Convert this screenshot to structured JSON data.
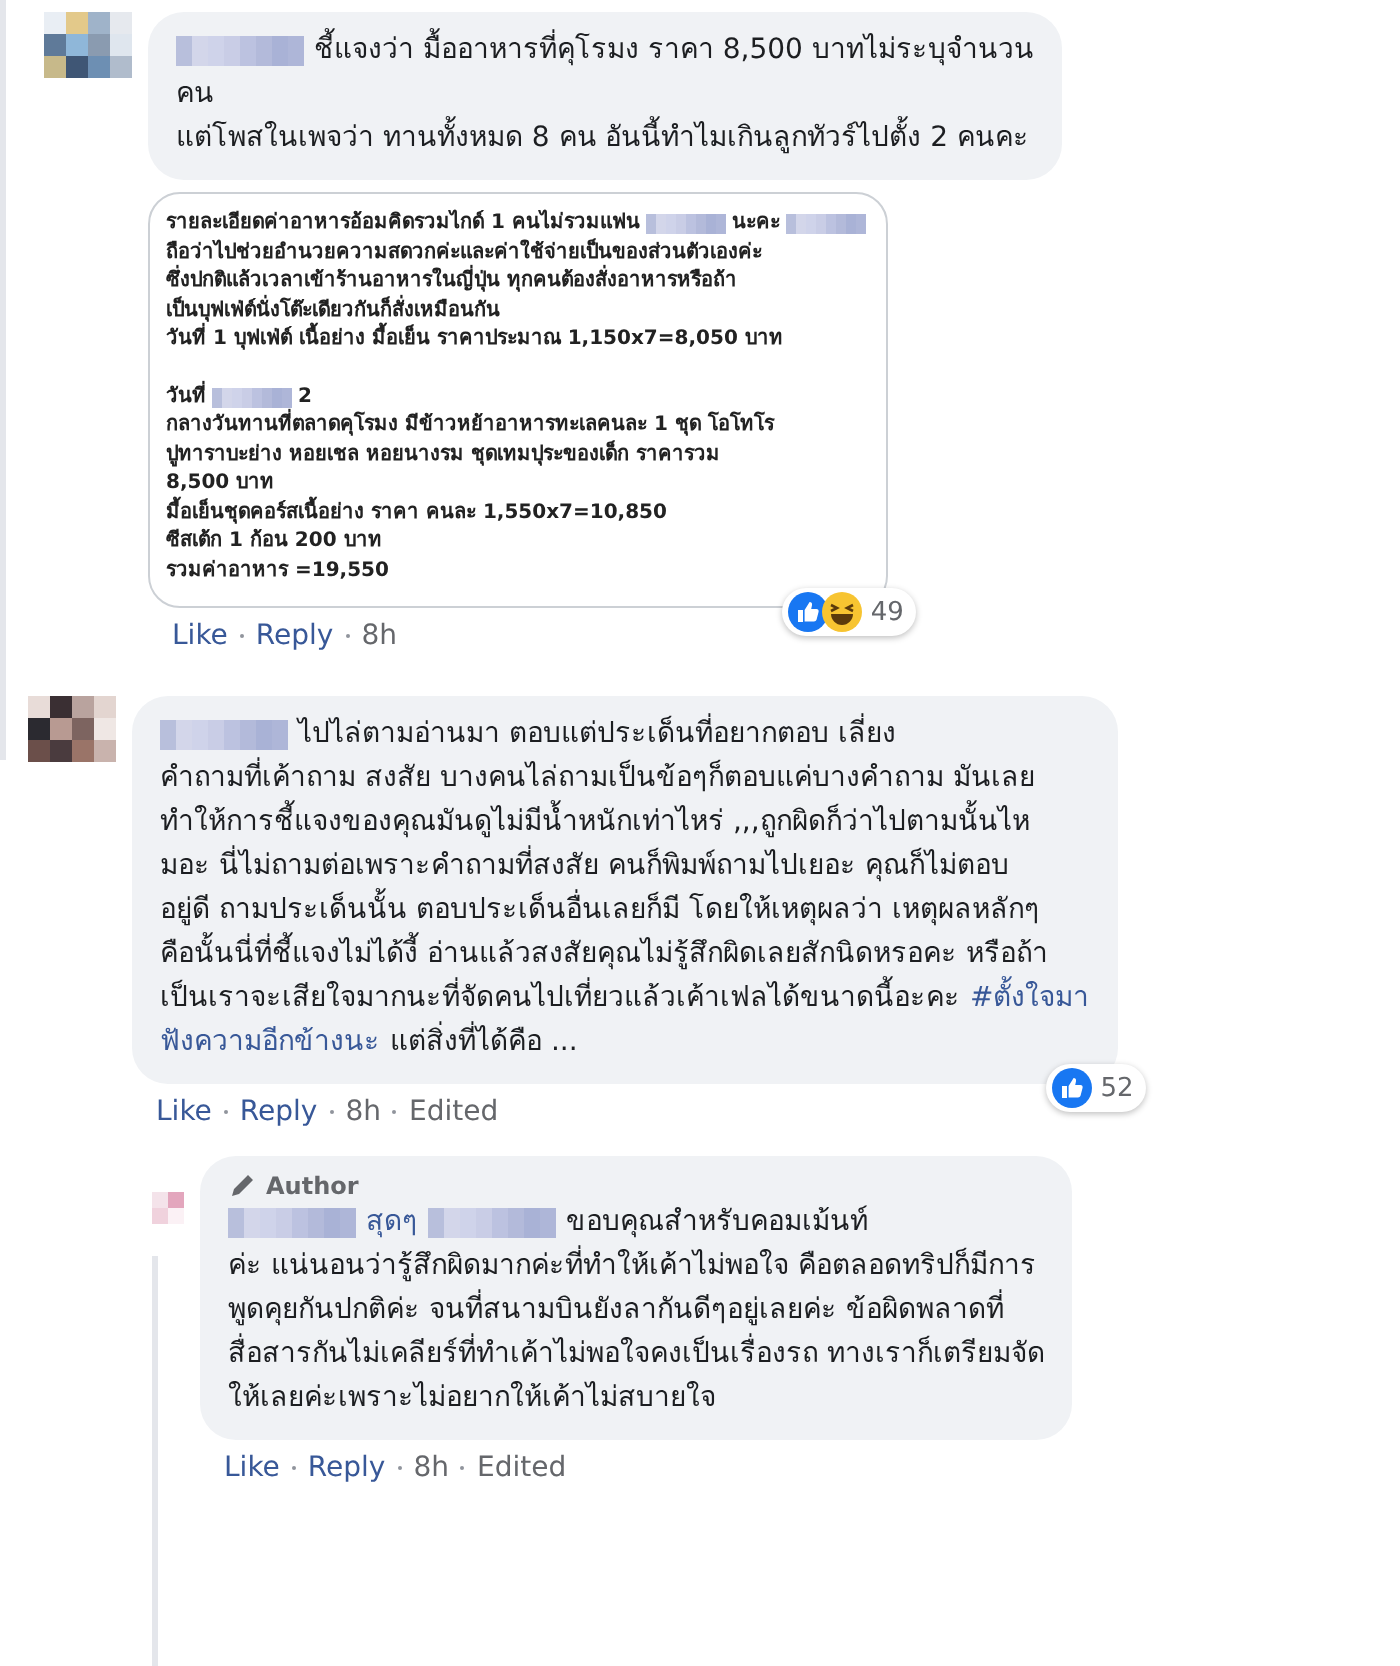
{
  "comments": [
    {
      "lines": [
        [
          {
            "kind": "blur"
          },
          {
            "kind": "text",
            "text": "ชี้แจงว่า มื้ออาหารที่คุโรมง ราคา 8,500 บาทไม่ระบุจำนวน"
          }
        ],
        [
          {
            "kind": "text",
            "text": "คน"
          }
        ],
        [
          {
            "kind": "text",
            "text": "แต่โพสในเพจว่า ทานทั้งหมด 8 คน อันนี้ทำไมเกินลูกทัวร์ไปตั้ง 2 คนคะ"
          }
        ]
      ],
      "attachment": {
        "paragraphs": [
          [
            [
              {
                "kind": "text",
                "text": "รายละเอียดค่าอาหารอ้อมคิดรวมไกด์ 1 คนไม่รวมแฟน"
              },
              {
                "kind": "blur"
              },
              {
                "kind": "text",
                "text": "นะคะ"
              },
              {
                "kind": "blur"
              }
            ],
            [
              {
                "kind": "text",
                "text": "ถือว่าไปช่วยอำนวยความสดวกค่ะและค่าใช้จ่ายเป็นของส่วนตัวเองค่ะ"
              }
            ],
            [
              {
                "kind": "text",
                "text": "ซึ่งปกติแล้วเวลาเข้าร้านอาหารในญี่ปุ่น ทุกคนต้องสั่งอาหารหรือถ้า"
              }
            ],
            [
              {
                "kind": "text",
                "text": "เป็นบุฟเฟ่ต์นั่งโต๊ะเดียวกันก็สั่งเหมือนกัน"
              }
            ],
            [
              {
                "kind": "text",
                "text": "วันที่ 1 บุฟเฟ่ต์ เนื้อย่าง มื้อเย็น ราคาประมาณ 1,150x7=8,050  บาท"
              }
            ]
          ],
          [
            [
              {
                "kind": "text",
                "text": "วันที่"
              },
              {
                "kind": "blur"
              },
              {
                "kind": "text",
                "text": "2"
              }
            ],
            [
              {
                "kind": "text",
                "text": "กลางวันทานที่ตลาดคุโรมง มีข้าวหย้าอาหารทะเลคนละ 1 ชุด โอโทโร"
              }
            ],
            [
              {
                "kind": "text",
                "text": "ปูทาราบะย่าง หอยเชล หอยนางรม ชุดเทมปุระของเด็ก ราคารวม"
              }
            ],
            [
              {
                "kind": "text",
                "text": "8,500 บาท"
              }
            ],
            [
              {
                "kind": "text",
                "text": "มื้อเย็นชุดคอร์สเนื้อย่าง ราคา คนละ 1,550x7=10,850"
              }
            ],
            [
              {
                "kind": "text",
                "text": "ซีสเต้ก 1 ก้อน 200 บาท"
              }
            ],
            [
              {
                "kind": "text",
                "text": "รวมค่าอาหาร =19,550"
              }
            ]
          ]
        ]
      },
      "reactions": {
        "icons": [
          {
            "kind": "like"
          },
          {
            "kind": "haha"
          }
        ],
        "count": "49"
      },
      "actions": [
        {
          "kind": "link",
          "text": "Like"
        },
        {
          "kind": "link",
          "text": "Reply"
        },
        {
          "kind": "time",
          "text": "8h"
        }
      ]
    },
    {
      "lines": [
        [
          {
            "kind": "blur"
          },
          {
            "kind": "text",
            "text": "ไปไล่ตามอ่านมา ตอบแต่ประเด็นที่อยากตอบ เลี่ยง"
          }
        ],
        [
          {
            "kind": "text",
            "text": "คำถามที่เค้าถาม สงสัย บางคนไล่ถามเป็นข้อๆก็ตอบแค่บางคำถาม มันเลย"
          }
        ],
        [
          {
            "kind": "text",
            "text": "ทำให้การชี้แจงของคุณมันดูไม่มีน้ำหนักเท่าไหร่ ,,,ถูกผิดก็ว่าไปตามนั้นไห"
          }
        ],
        [
          {
            "kind": "text",
            "text": "มอะ นี่ไม่ถามต่อเพราะคำถามที่สงสัย คนก็พิมพ์ถามไปเยอะ คุณก็ไม่ตอบ"
          }
        ],
        [
          {
            "kind": "text",
            "text": "อยู่ดี ถามประเด็นนั้น ตอบประเด็นอื่นเลยก็มี โดยให้เหตุผลว่า เหตุผลหลักๆ"
          }
        ],
        [
          {
            "kind": "text",
            "text": "คือนั้นนี่ที่ชี้แจงไม่ได้งี้ อ่านแล้วสงสัยคุณไม่รู้สึกผิดเลยสักนิดหรอคะ หรือถ้า"
          }
        ],
        [
          {
            "kind": "text",
            "text": "เป็นเราจะเสียใจมากนะที่จัดคนไปเที่ยวแล้วเค้าเฟลได้ขนาดนี้อะคะ"
          },
          {
            "kind": "hashtag",
            "text": "#ตั้งใจมา"
          }
        ],
        [
          {
            "kind": "hashtag",
            "text": "ฟังความอีกข้างนะ"
          },
          {
            "kind": "text",
            "text": "แต่สิ่งที่ได้คือ ..."
          }
        ]
      ],
      "reactions": {
        "icons": [
          {
            "kind": "like"
          }
        ],
        "count": "52"
      },
      "actions": [
        {
          "kind": "link",
          "text": "Like"
        },
        {
          "kind": "link",
          "text": "Reply"
        },
        {
          "kind": "time",
          "text": "8h"
        },
        {
          "kind": "note",
          "text": "Edited"
        }
      ],
      "replies": [
        {
          "badge": "Author",
          "lines": [
            [
              {
                "kind": "blur"
              },
              {
                "kind": "hashtag",
                "text": "สุดๆ"
              },
              {
                "kind": "blur"
              },
              {
                "kind": "text",
                "text": "ขอบคุณสำหรับคอมเม้นท์"
              }
            ],
            [
              {
                "kind": "text",
                "text": "ค่ะ แน่นอนว่ารู้สึกผิดมากค่ะที่ทำให้เค้าไม่พอใจ คือตลอดทริปก็มีการ"
              }
            ],
            [
              {
                "kind": "text",
                "text": "พูดคุยกันปกติค่ะ จนที่สนามบินยังลากันดีๆอยู่เลยค่ะ ข้อผิดพลาดที่"
              }
            ],
            [
              {
                "kind": "text",
                "text": "สื่อสารกันไม่เคลียร์ที่ทำเค้าไม่พอใจคงเป็นเรื่องรถ ทางเราก็เตรียมจัด"
              }
            ],
            [
              {
                "kind": "text",
                "text": "ให้เลยค่ะเพราะไม่อยากให้เค้าไม่สบายใจ"
              }
            ]
          ],
          "actions": [
            {
              "kind": "link",
              "text": "Like"
            },
            {
              "kind": "link",
              "text": "Reply"
            },
            {
              "kind": "time",
              "text": "8h"
            },
            {
              "kind": "note",
              "text": "Edited"
            }
          ]
        }
      ]
    }
  ]
}
